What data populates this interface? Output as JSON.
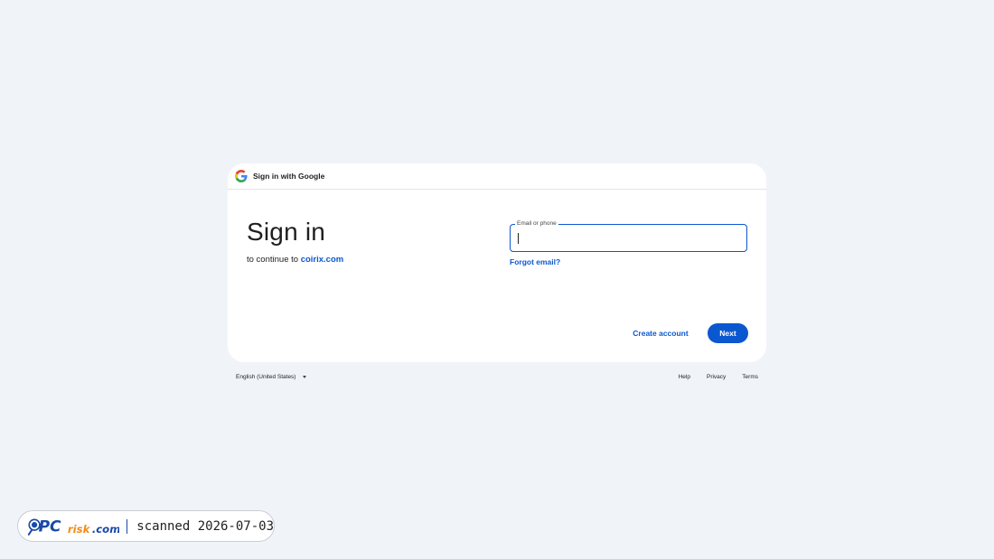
{
  "header": {
    "brand_text": "Sign in with Google",
    "logo_icon": "google-g-icon"
  },
  "main": {
    "title": "Sign in",
    "subtitle_prefix": "to continue to",
    "site_link": "coirix.com"
  },
  "form": {
    "email_label": "Email or phone",
    "email_value": "",
    "forgot_email": "Forgot email?",
    "create_account": "Create account",
    "next": "Next"
  },
  "footer": {
    "language": "English (United States)",
    "links": [
      "Help",
      "Privacy",
      "Terms"
    ]
  },
  "watermark": {
    "brand": "PCrisk.com",
    "scan_text": "scanned 2026-07-03"
  },
  "colors": {
    "background": "#f0f4f9",
    "card": "#ffffff",
    "accent": "#0b57d0",
    "text": "#1f1f1f"
  }
}
